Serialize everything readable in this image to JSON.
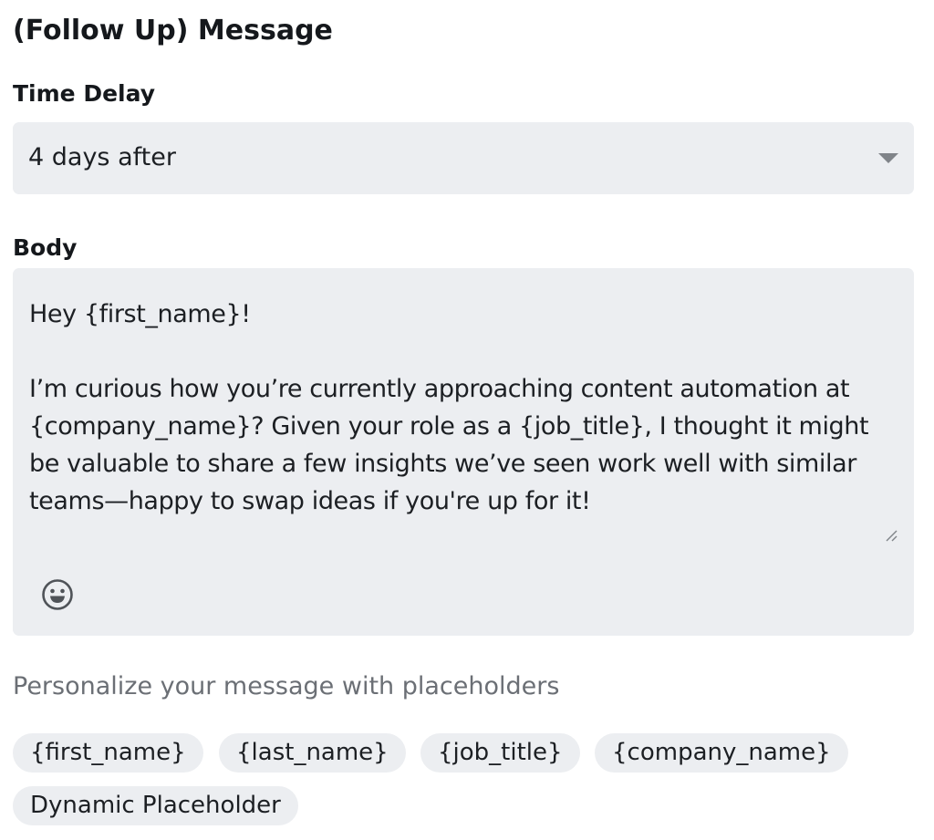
{
  "form": {
    "title": "(Follow Up) Message"
  },
  "time_delay": {
    "label": "Time Delay",
    "selected": "4 days after",
    "dropdown_icon": "caret-down-icon"
  },
  "body": {
    "label": "Body",
    "value": "Hey {first_name}!\n\nI’m curious how you’re currently approaching content automation at {company_name}? Given your role as a {job_title}, I thought it might be valuable to share a few insights we’ve seen work well with similar teams—happy to swap ideas if you're up for it!",
    "emoji_icon": "smiley-face-icon",
    "resize_icon": "resize-handle-icon"
  },
  "placeholders": {
    "helper_text": "Personalize your message with placeholders",
    "chips": [
      "{first_name}",
      "{last_name}",
      "{job_title}",
      "{company_name}",
      "Dynamic Placeholder"
    ]
  },
  "colors": {
    "field_background": "#eceef1",
    "text": "#1c1f23",
    "muted_text": "#6b6f75",
    "icon": "#808489"
  }
}
